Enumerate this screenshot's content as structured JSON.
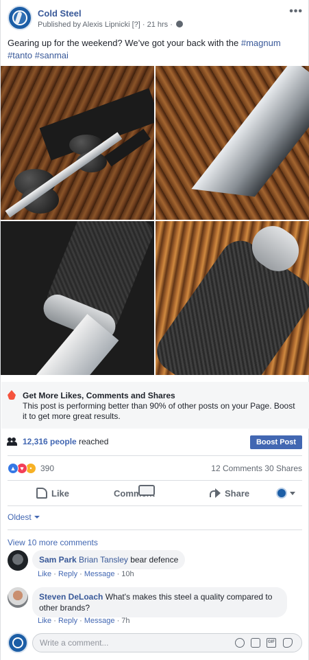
{
  "post": {
    "page_name": "Cold Steel",
    "byline": "Published by Alexis Lipnicki [?] · 21 hrs ·",
    "text_prefix": "Gearing up for the weekend? We’ve got your back with the ",
    "hashtags": [
      "#magnum",
      "#tanto",
      "#sanmai"
    ],
    "more_icon": "more-horizontal-icon",
    "privacy_icon": "globe-icon"
  },
  "photos": [
    {
      "name": "photo-knife-with-stones"
    },
    {
      "name": "photo-blade-tip-closeup"
    },
    {
      "name": "photo-guard-closeup"
    },
    {
      "name": "photo-handle-closeup"
    }
  ],
  "boost_banner": {
    "title": "Get More Likes, Comments and Shares",
    "description": "This post is performing better than 90% of other posts on your Page. Boost it to get more great results."
  },
  "reach": {
    "count": "12,316 people",
    "label": "reached",
    "boost_label": "Boost Post"
  },
  "stats": {
    "reaction_count": "390",
    "comments": "12 Comments",
    "shares": "30 Shares"
  },
  "actions": {
    "like": "Like",
    "comment": "Comment",
    "share": "Share"
  },
  "sort": {
    "label": "Oldest"
  },
  "view_more": "View 10 more comments",
  "comments": [
    {
      "author": "Sam Park",
      "mention": "Brian Tansley",
      "text": " bear defence",
      "like": "Like",
      "reply": "Reply",
      "message": "Message",
      "time": "10h"
    },
    {
      "author": "Steven DeLoach",
      "text": " What's makes this steel a quality compared to other brands?",
      "like": "Like",
      "reply": "Reply",
      "message": "Message",
      "time": "7h"
    }
  ],
  "composer": {
    "placeholder": "Write a comment..."
  },
  "colors": {
    "brand_blue": "#4267b2",
    "link_blue": "#385898",
    "like_blue": "#3578e5",
    "love_red": "#f33e58",
    "wow_yellow": "#f7b125",
    "fire_orange": "#f5533d"
  }
}
